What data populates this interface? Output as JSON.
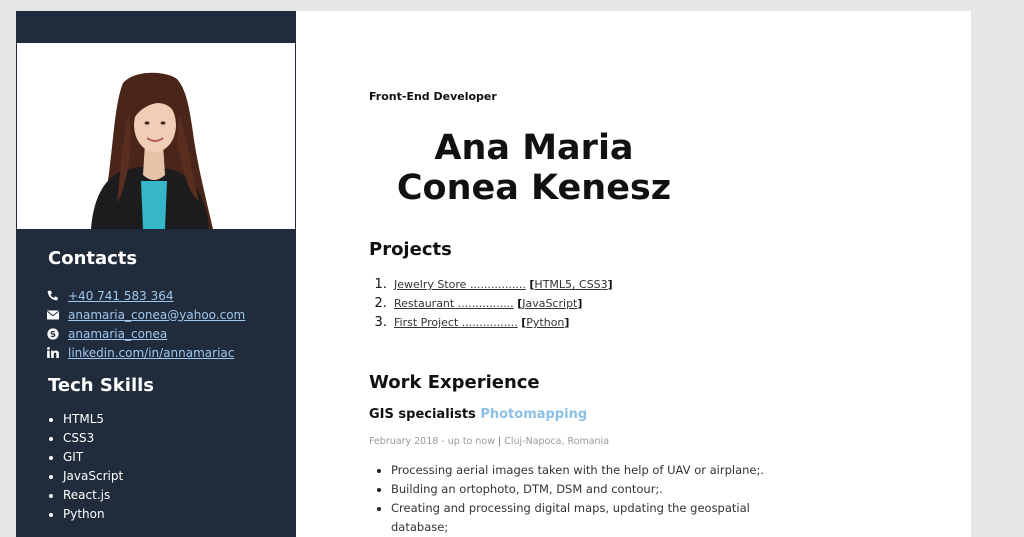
{
  "header": {
    "subtitle": "Front-End Developer",
    "name": "Ana Maria Conea Kenesz"
  },
  "contacts": {
    "heading": "Contacts",
    "items": [
      {
        "icon": "phone-icon",
        "text": "+40 741 583 364"
      },
      {
        "icon": "envelope-icon",
        "text": "anamaria_conea@yahoo.com"
      },
      {
        "icon": "skype-icon",
        "text": "anamaria_conea"
      },
      {
        "icon": "linkedin-icon",
        "text": "linkedin.com/in/annamariac"
      }
    ]
  },
  "skills": {
    "heading": "Tech Skills",
    "items": [
      "HTML5",
      "CSS3",
      "GIT",
      "JavaScript",
      "React.js",
      "Python"
    ]
  },
  "projects": {
    "heading": "Projects",
    "items": [
      {
        "name": "Jewelry Store",
        "dots": "................",
        "tech": "HTML5, CSS3"
      },
      {
        "name": "Restaurant",
        "dots": "................",
        "tech": "JavaScript"
      },
      {
        "name": "First Project",
        "dots": "................",
        "tech": "Python"
      }
    ]
  },
  "work": {
    "heading": "Work Experience",
    "job_title": "GIS specialists",
    "company": "Photomapping",
    "dates": "February 2018 - up to now",
    "separator": "|",
    "location": "Cluj-Napoca, Romania",
    "duties": [
      "Processing aerial images taken with the help of UAV or airplane;.",
      "Building an ortophoto, DTM, DSM and contour;.",
      "Creating and processing digital maps, updating the geospatial database;"
    ]
  },
  "colors": {
    "sidebar": "#202b3c",
    "link": "#9fc8ee",
    "accent": "#8cc0e6"
  }
}
